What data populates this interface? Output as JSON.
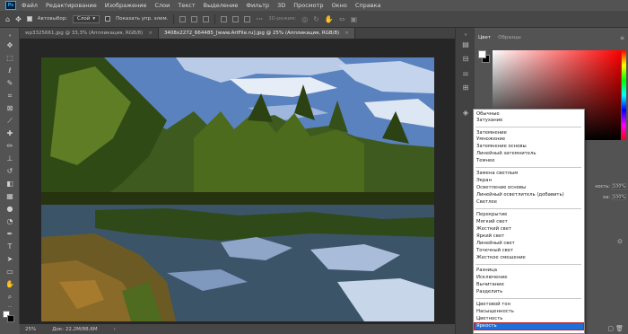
{
  "menubar": {
    "logo": "Ps",
    "items": [
      "Файл",
      "Редактирование",
      "Изображение",
      "Слои",
      "Текст",
      "Выделение",
      "Фильтр",
      "3D",
      "Просмотр",
      "Окно",
      "Справка"
    ]
  },
  "options": {
    "autoselect_label": "Автовыбор:",
    "autoselect_value": "Слой",
    "show_transform_label": "Показать упр. элем.",
    "mode_3d": "3D-режим:"
  },
  "tabs": [
    {
      "label": "wp3325661.jpg @ 33,3% (Аппликация, RGB/8)",
      "close": "×"
    },
    {
      "label": "3408x2272_664485_[www.ArtFile.ru].jpg @ 25% (Аппликация, RGB/8)",
      "close": "×"
    }
  ],
  "status": {
    "zoom": "25%",
    "doc": "Док: 22,2M/88,6M"
  },
  "panel": {
    "tab_color": "Цвет",
    "tab_swatches": "Образцы",
    "opacity_label": "Непрозрачность:",
    "opacity_value": "100%",
    "fill_label": "Заливка:",
    "fill_value": "100%",
    "short_opacity": "ность:",
    "short_fill": "ка:"
  },
  "blend_modes": {
    "group1": [
      "Обычные",
      "Затухание"
    ],
    "group2": [
      "Затемнение",
      "Умножение",
      "Затемнение основы",
      "Линейный затемнитель",
      "Темнее"
    ],
    "group3": [
      "Замена светлым",
      "Экран",
      "Осветление основы",
      "Линейный осветлитель (добавить)",
      "Светлее"
    ],
    "group4": [
      "Перекрытие",
      "Мягкий свет",
      "Жесткий свет",
      "Яркий свет",
      "Линейный свет",
      "Точечный свет",
      "Жесткое смешение"
    ],
    "group5": [
      "Разница",
      "Исключение",
      "Вычитание",
      "Разделить"
    ],
    "group6": [
      "Цветовой тон",
      "Насыщенность",
      "Цветность",
      "Яркость"
    ],
    "selected": "Яркость"
  },
  "colors": {
    "accent_highlight": "#1e6fd9",
    "highlight_border": "#c02020",
    "app_bg": "#535353",
    "canvas_bg": "#262626"
  }
}
